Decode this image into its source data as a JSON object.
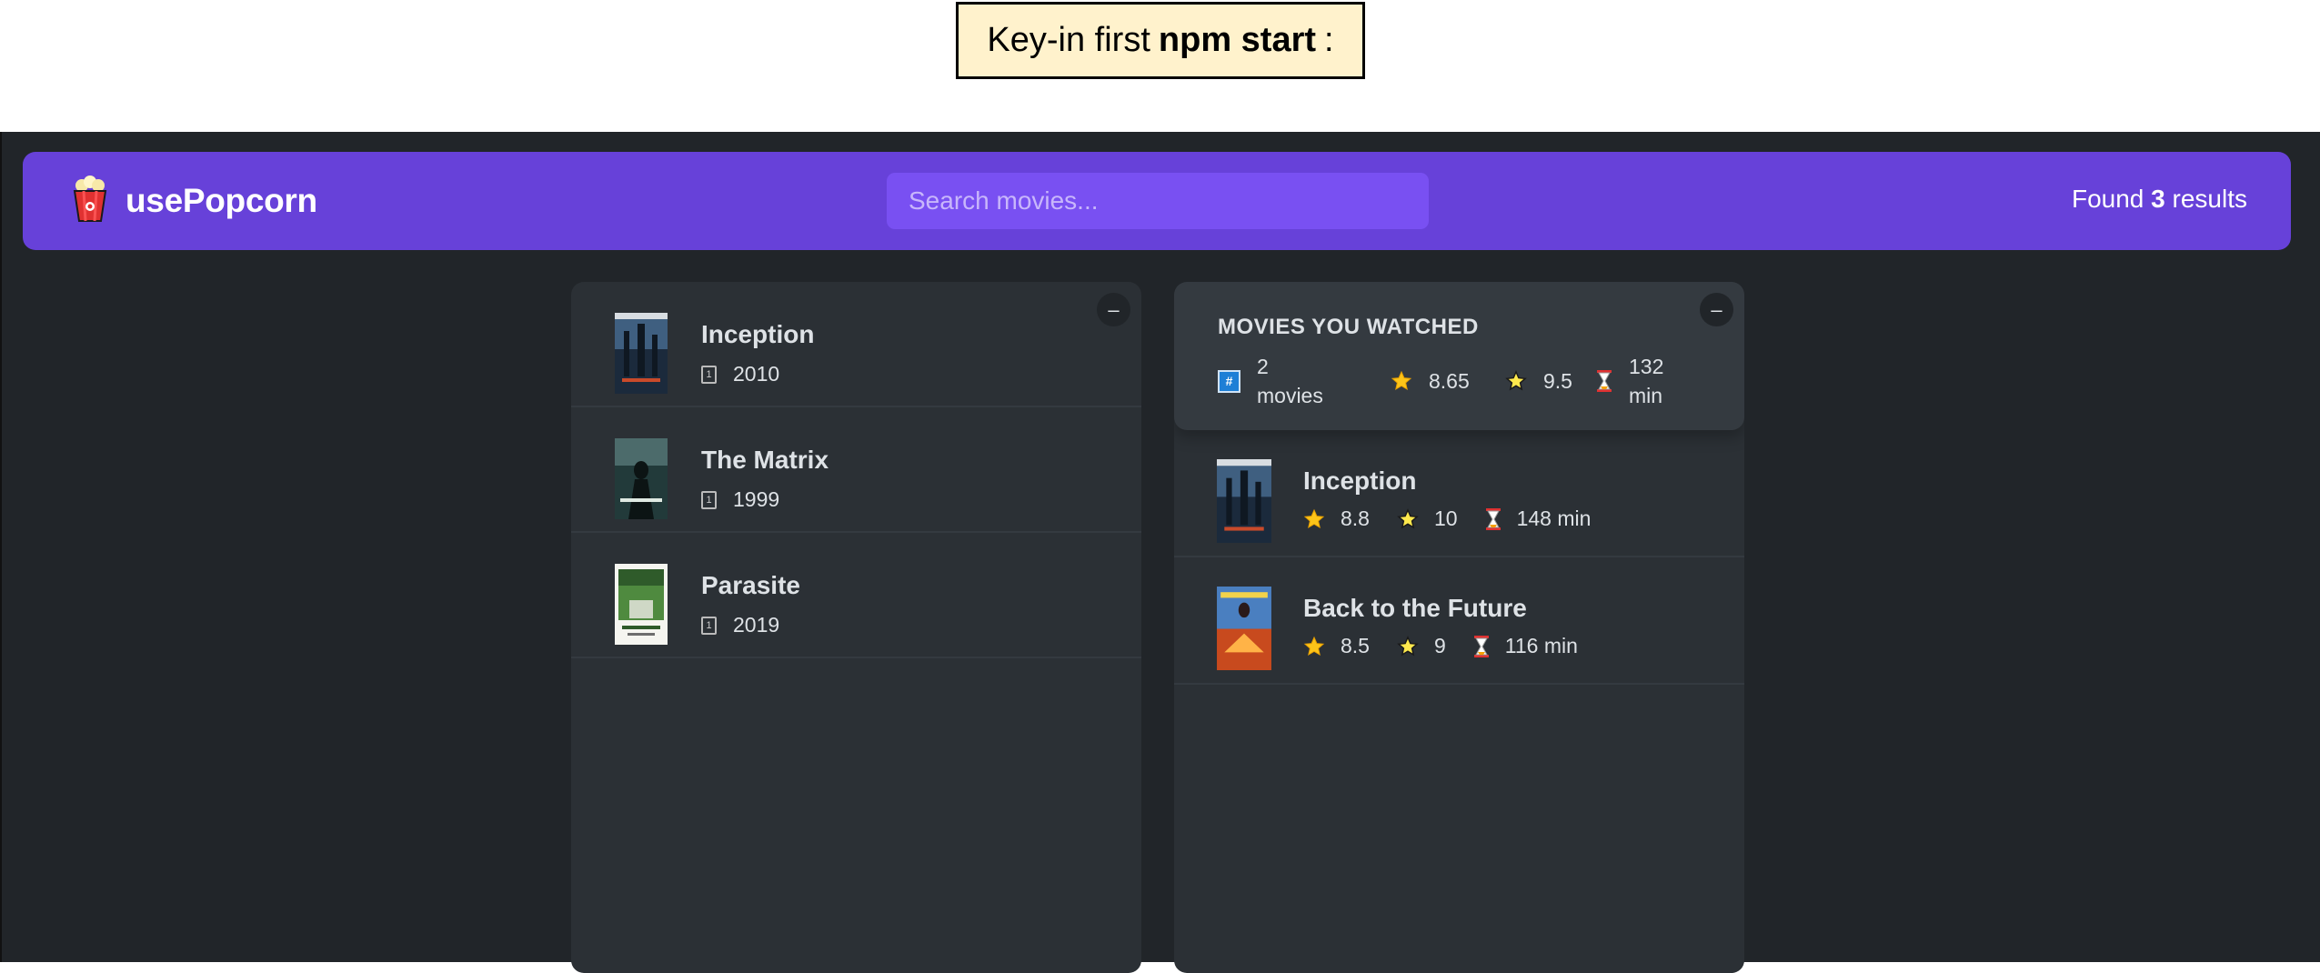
{
  "note": {
    "prefix": "Key-in first",
    "command": "npm start",
    "suffix": ":"
  },
  "navbar": {
    "logo_text": "usePopcorn",
    "search_placeholder": "Search movies...",
    "found_prefix": "Found",
    "found_count": "3",
    "found_suffix": "results"
  },
  "search_results": {
    "toggle": "–",
    "movies": [
      {
        "title": "Inception",
        "year": "2010"
      },
      {
        "title": "The Matrix",
        "year": "1999"
      },
      {
        "title": "Parasite",
        "year": "2019"
      }
    ]
  },
  "watched": {
    "toggle": "–",
    "summary": {
      "heading": "MOVIES YOU WATCHED",
      "count_line1": "2",
      "count_line2": "movies",
      "avg_imdb": "8.65",
      "avg_user": "9.5",
      "runtime_line1": "132",
      "runtime_line2": "min"
    },
    "movies": [
      {
        "title": "Inception",
        "imdb": "8.8",
        "user": "10",
        "runtime": "148 min"
      },
      {
        "title": "Back to the Future",
        "imdb": "8.5",
        "user": "9",
        "runtime": "116 min"
      }
    ]
  },
  "colors": {
    "primary": "#6741d9",
    "primary_light": "#7950f2",
    "background": "#212529",
    "box": "#2b3035",
    "summary": "#343a40",
    "note_bg": "#fff2cc"
  }
}
